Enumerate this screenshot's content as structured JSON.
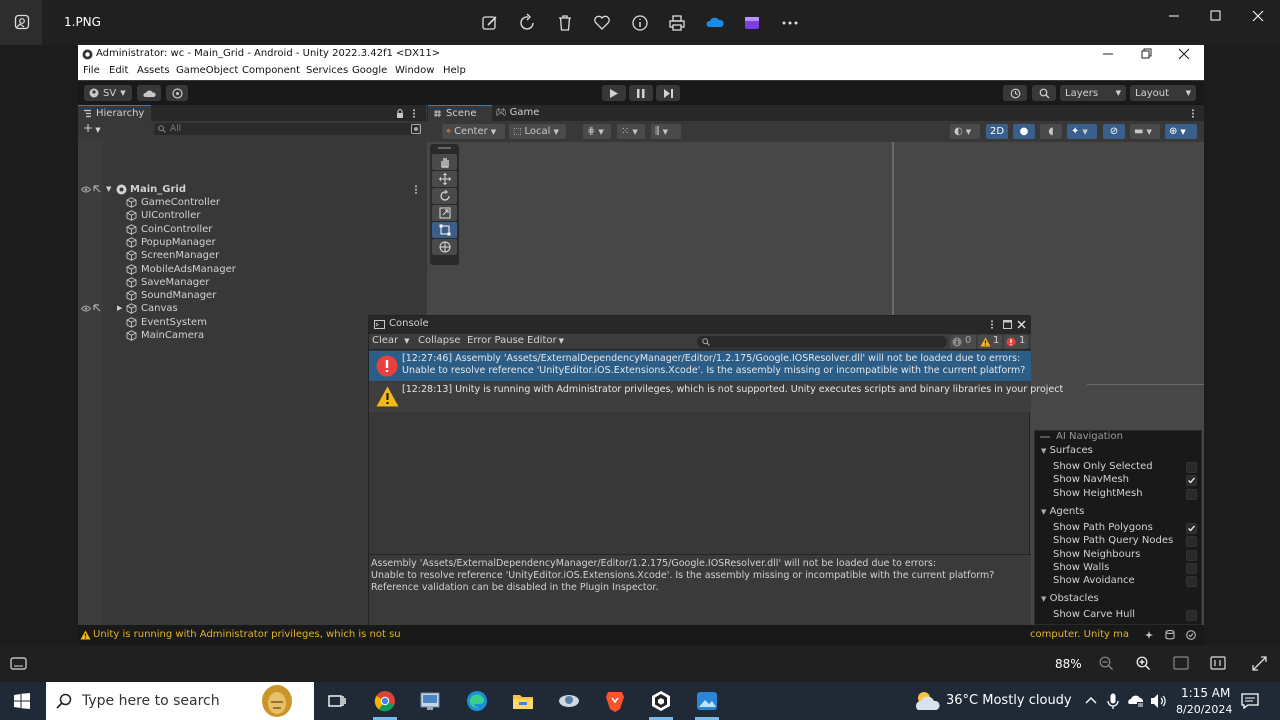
{
  "viewer": {
    "filename": "1.PNG",
    "zoom": "88%",
    "top_icons": [
      "edit-icon",
      "rotate-icon",
      "delete-icon",
      "favorite-icon",
      "info-icon",
      "print-icon",
      "onedrive-icon",
      "clipchamp-icon",
      "more-icon"
    ]
  },
  "unity": {
    "title": "Administrator: wc - Main_Grid - Android - Unity 2022.3.42f1 <DX11>",
    "menu": [
      "File",
      "Edit",
      "Assets",
      "GameObject",
      "Component",
      "Services",
      "Google",
      "Window",
      "Help"
    ],
    "toolbar": {
      "account": "SV",
      "layers": "Layers",
      "layout": "Layout"
    },
    "hierarchy": {
      "tab": "Hierarchy",
      "search_placeholder": "All",
      "scene": "Main_Grid",
      "items": [
        "GameController",
        "UIController",
        "CoinController",
        "PopupManager",
        "ScreenManager",
        "MobileAdsManager",
        "SaveManager",
        "SoundManager",
        "Canvas",
        "EventSystem",
        "MainCamera"
      ]
    },
    "scene": {
      "tabs": [
        "Scene",
        "Game"
      ],
      "pivot": "Center",
      "space": "Local",
      "mode_2d": "2D"
    },
    "console": {
      "tab": "Console",
      "toolbar": {
        "clear": "Clear",
        "collapse": "Collapse",
        "error_pause": "Error Pause",
        "editor": "Editor"
      },
      "counts": {
        "log": "0",
        "warning": "1",
        "error": "1"
      },
      "messages": [
        {
          "type": "error",
          "line1": "[12:27:46] Assembly 'Assets/ExternalDependencyManager/Editor/1.2.175/Google.IOSResolver.dll' will not be loaded due to errors:",
          "line2": "Unable to resolve reference 'UnityEditor.iOS.Extensions.Xcode'. Is the assembly missing or incompatible with the current platform?"
        },
        {
          "type": "warning",
          "line1": "[12:28:13] Unity is running with Administrator privileges, which is not supported. Unity executes scripts and binary libraries in your project"
        }
      ],
      "detail": [
        "Assembly 'Assets/ExternalDependencyManager/Editor/1.2.175/Google.IOSResolver.dll' will not be loaded due to errors:",
        "Unable to resolve reference 'UnityEditor.iOS.Extensions.Xcode'. Is the assembly missing or incompatible with the current platform?",
        "Reference validation can be disabled in the Plugin Inspector."
      ]
    },
    "ai_navigation": {
      "title": "AI Navigation",
      "sections": [
        {
          "name": "Surfaces",
          "items": [
            {
              "label": "Show Only Selected",
              "checked": false
            },
            {
              "label": "Show NavMesh",
              "checked": true
            },
            {
              "label": "Show HeightMesh",
              "checked": false
            }
          ]
        },
        {
          "name": "Agents",
          "items": [
            {
              "label": "Show Path Polygons",
              "checked": true
            },
            {
              "label": "Show Path Query Nodes",
              "checked": false
            },
            {
              "label": "Show Neighbours",
              "checked": false
            },
            {
              "label": "Show Walls",
              "checked": false
            },
            {
              "label": "Show Avoidance",
              "checked": false
            }
          ]
        },
        {
          "name": "Obstacles",
          "items": [
            {
              "label": "Show Carve Hull",
              "checked": false
            }
          ]
        }
      ]
    },
    "status": {
      "left": "Unity is running with Administrator privileges, which is not su",
      "right": "computer. Unity ma"
    }
  },
  "taskbar": {
    "search_placeholder": "Type here to search",
    "weather": "36°C  Mostly cloudy",
    "time": "1:15 AM",
    "date": "8/20/2024"
  }
}
